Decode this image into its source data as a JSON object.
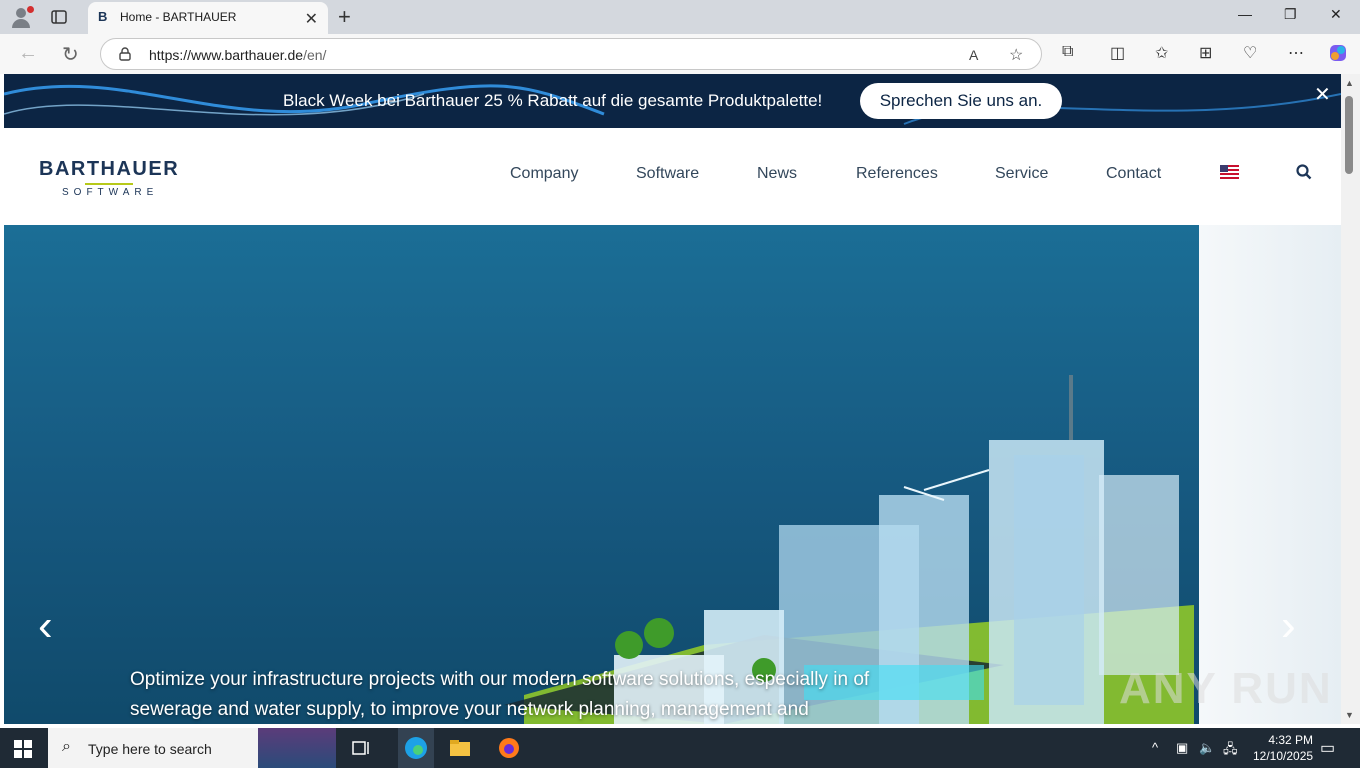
{
  "browser": {
    "tab_title": "Home - BARTHAUER",
    "tab_favicon": "B",
    "url_host": "https://www.barthauer.de",
    "url_path": "/en/"
  },
  "promo": {
    "text": "Black Week bei Barthauer 25 % Rabatt auf die gesamte Produktpalette!",
    "cta": "Sprechen Sie uns an."
  },
  "site": {
    "logo_name": "BARTHAUER",
    "logo_sub": "SOFTWARE",
    "nav": [
      "Company",
      "Software",
      "News",
      "References",
      "Service",
      "Contact"
    ]
  },
  "hero": {
    "caption": "Optimize your infrastructure projects with our modern software solutions, especially in of sewerage and water supply, to improve your network planning, management and"
  },
  "watermark": "ANY RUN",
  "taskbar": {
    "search_placeholder": "Type here to search",
    "time": "4:32 PM",
    "date": "12/10/2025"
  },
  "colors": {
    "brand_navy": "#1c3557",
    "brand_green": "#b7c91a",
    "promo_bg": "#0c2544",
    "hero_blue": "#1b6e96"
  }
}
